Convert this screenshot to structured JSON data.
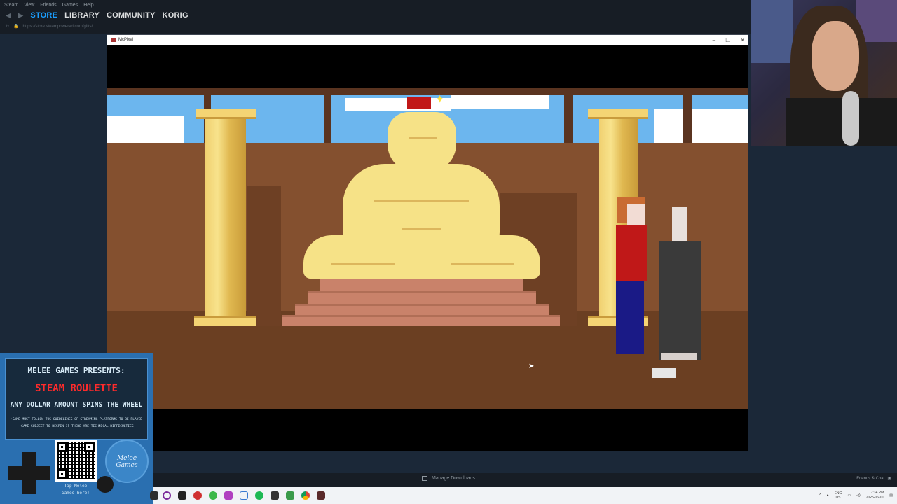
{
  "steam": {
    "menu": [
      "Steam",
      "View",
      "Friends",
      "Games",
      "Help"
    ],
    "nav_tabs": [
      "STORE",
      "LIBRARY",
      "COMMUNITY",
      "KORIG"
    ],
    "active_tab": "STORE",
    "url": "https://store.steampowered.com/gifts/",
    "manage_downloads": "Manage Downloads",
    "friends_chat": "Friends & Chat"
  },
  "game_window": {
    "title": "McPixel",
    "controls": [
      "–",
      "☐",
      "✕"
    ]
  },
  "overlay": {
    "presents": "MELEE GAMES PRESENTS:",
    "title": "STEAM ROULETTE",
    "subtitle": "ANY DOLLAR AMOUNT SPINS THE WHEEL",
    "rule1": "•GAME MUST FOLLOW TOS GUIDELINES OF STREAMING PLATFORMS TO BE PLAYED",
    "rule2": "•GAME SUBJECT TO RESPIN IF THERE ARE TECHNICAL DIFFICULTIES",
    "tip_line1": "Tip Melee",
    "tip_line2": "Games here!",
    "logo_text": "Melee Games"
  },
  "taskbar": {
    "lang_top": "ENG",
    "lang_bottom": "US",
    "time": "7:34 PM",
    "date": "2025-06-01"
  },
  "colors": {
    "steam_bg": "#1b2838",
    "steam_accent": "#1a9fff",
    "roulette_red": "#ff2b2b",
    "overlay_blue": "#2a6fb0"
  }
}
